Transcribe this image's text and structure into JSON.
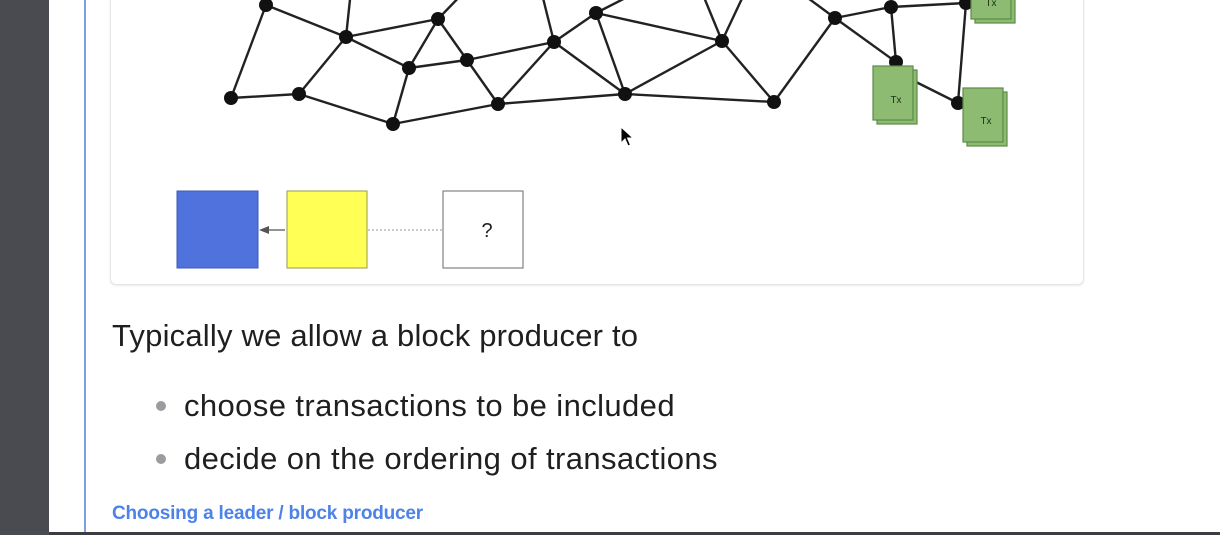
{
  "figure": {
    "tx_label": "Tx",
    "unknown_block_label": "?",
    "colors": {
      "block_1": "#4f72dd",
      "block_2": "#ffff55",
      "tx_fill": "#8dbb72",
      "tx_stroke": "#5c8a48"
    }
  },
  "text": {
    "intro": "Typically we allow a block producer to",
    "bullets": [
      "choose transactions to be included",
      "decide on the ordering of transactions"
    ]
  },
  "link": {
    "label": "Choosing a leader / block producer"
  },
  "colors": {
    "accent": "#4d82e8",
    "rule": "#7b9fe0"
  }
}
